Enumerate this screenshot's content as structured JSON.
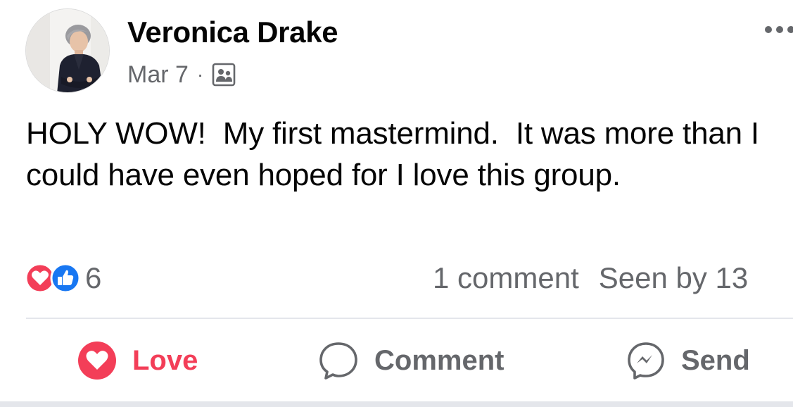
{
  "post": {
    "author": "Veronica Drake",
    "date": "Mar 7",
    "separator": "·",
    "audience_icon": "group-icon",
    "text": "HOLY WOW!  My first mastermind.  It was more than I could have even hoped for I love this group.",
    "reactions": {
      "icons": [
        "love-reaction-icon",
        "like-reaction-icon"
      ],
      "count": "6"
    },
    "comments_label": "1 comment",
    "seen_by_label": "Seen by 13"
  },
  "actions": {
    "love": "Love",
    "comment": "Comment",
    "send": "Send"
  },
  "colors": {
    "love": "#f33e58",
    "like": "#1877f2",
    "secondary_text": "#65676b",
    "divider": "#e4e6eb"
  }
}
